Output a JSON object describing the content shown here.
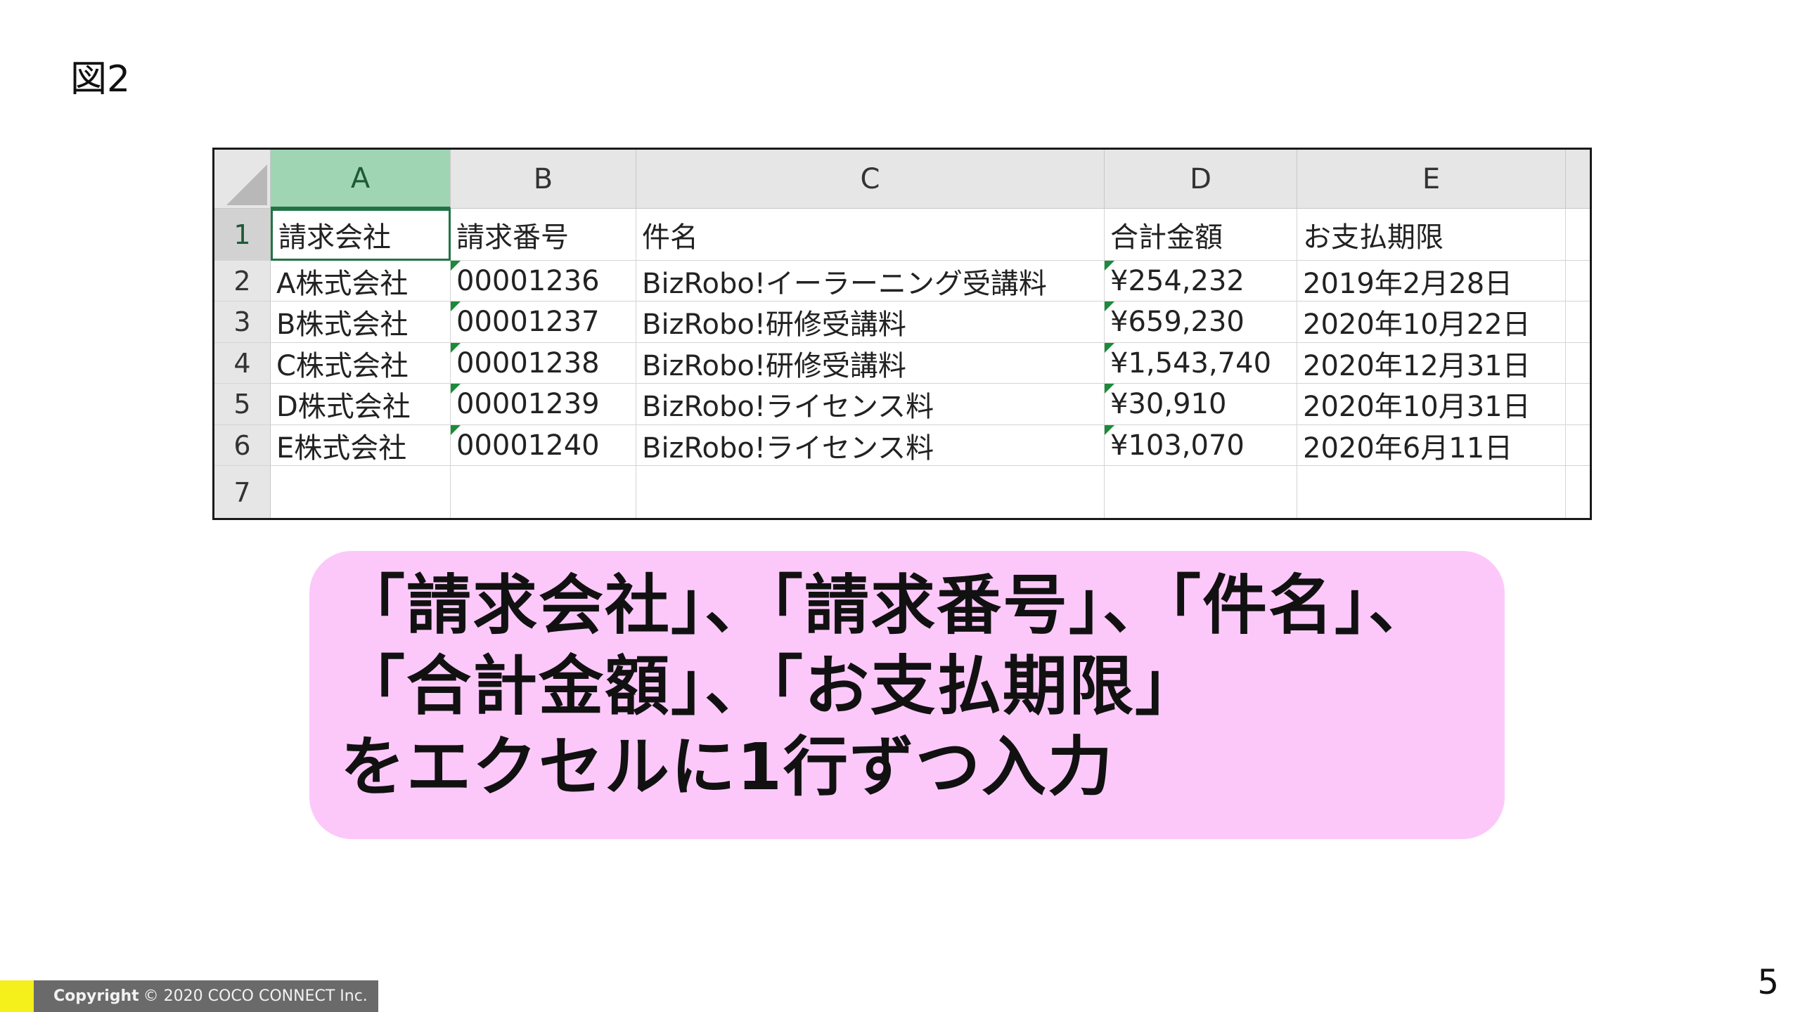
{
  "figure_label": "図2",
  "sheet": {
    "columns": [
      "A",
      "B",
      "C",
      "D",
      "E"
    ],
    "row_numbers": [
      "1",
      "2",
      "3",
      "4",
      "5",
      "6",
      "7"
    ],
    "rows": [
      [
        "請求会社",
        "請求番号",
        "件名",
        "合計金額",
        "お支払期限"
      ],
      [
        "A株式会社",
        "00001236",
        "BizRobo!イーラーニング受講料",
        "¥254,232",
        "2019年2月28日"
      ],
      [
        "B株式会社",
        "00001237",
        "BizRobo!研修受講料",
        "¥659,230",
        "2020年10月22日"
      ],
      [
        "C株式会社",
        "00001238",
        "BizRobo!研修受講料",
        "¥1,543,740",
        "2020年12月31日"
      ],
      [
        "D株式会社",
        "00001239",
        "BizRobo!ライセンス料",
        "¥30,910",
        "2020年10月31日"
      ],
      [
        "E株式会社",
        "00001240",
        "BizRobo!ライセンス料",
        "¥103,070",
        "2020年6月11日"
      ],
      [
        "",
        "",
        "",
        "",
        ""
      ]
    ],
    "selected_cell": "A1",
    "accent_color": "#217346"
  },
  "note": {
    "lines": [
      "「請求会社」、「請求番号」、「件名」、",
      "「合計金額」、「お支払期限」",
      "をエクセルに1行ずつ入力"
    ],
    "background": "#fcc8f9"
  },
  "footer": {
    "copyright_label": "Copyright",
    "copyright_text": "© 2020 COCO CONNECT Inc.",
    "page_number": "5"
  }
}
